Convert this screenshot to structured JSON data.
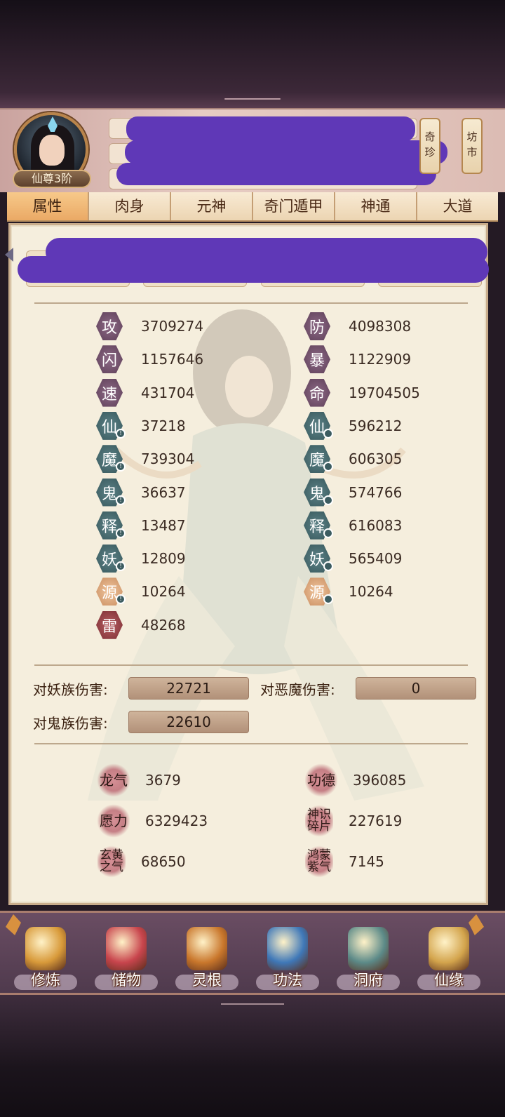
{
  "header": {
    "rank": "仙尊3阶",
    "side_buttons": [
      "奇珍",
      "坊市"
    ]
  },
  "tabs": [
    "属性",
    "肉身",
    "元神",
    "奇门遁甲",
    "神通",
    "大道"
  ],
  "active_tab": 0,
  "stats_left": [
    {
      "glyph": "攻",
      "value": "3709274",
      "style": "purple",
      "badge": ""
    },
    {
      "glyph": "闪",
      "value": "1157646",
      "style": "purple",
      "badge": ""
    },
    {
      "glyph": "速",
      "value": "431704",
      "style": "purple",
      "badge": ""
    },
    {
      "glyph": "仙",
      "value": "37218",
      "style": "teal",
      "badge": "!"
    },
    {
      "glyph": "魔",
      "value": "739304",
      "style": "teal",
      "badge": "!"
    },
    {
      "glyph": "鬼",
      "value": "36637",
      "style": "teal",
      "badge": "!"
    },
    {
      "glyph": "释",
      "value": "13487",
      "style": "teal",
      "badge": "!"
    },
    {
      "glyph": "妖",
      "value": "12809",
      "style": "teal",
      "badge": "!"
    },
    {
      "glyph": "源",
      "value": "10264",
      "style": "orange",
      "badge": "!"
    },
    {
      "glyph": "雷",
      "value": "48268",
      "style": "red",
      "badge": ""
    }
  ],
  "stats_right": [
    {
      "glyph": "防",
      "value": "4098308",
      "style": "purple",
      "badge": ""
    },
    {
      "glyph": "暴",
      "value": "1122909",
      "style": "purple",
      "badge": ""
    },
    {
      "glyph": "命",
      "value": "19704505",
      "style": "purple",
      "badge": ""
    },
    {
      "glyph": "仙",
      "value": "596212",
      "style": "teal",
      "badge": "o"
    },
    {
      "glyph": "魔",
      "value": "606305",
      "style": "teal",
      "badge": "o"
    },
    {
      "glyph": "鬼",
      "value": "574766",
      "style": "teal",
      "badge": "o"
    },
    {
      "glyph": "释",
      "value": "616083",
      "style": "teal",
      "badge": "o"
    },
    {
      "glyph": "妖",
      "value": "565409",
      "style": "teal",
      "badge": "o"
    },
    {
      "glyph": "源",
      "value": "10264",
      "style": "orange",
      "badge": "o"
    }
  ],
  "damage": {
    "yao_label": "对妖族伤害:",
    "yao_value": "22721",
    "demon_label": "对恶魔伤害:",
    "demon_value": "0",
    "ghost_label": "对鬼族伤害:",
    "ghost_value": "22610"
  },
  "misc": [
    {
      "label": "龙气",
      "value": "3679"
    },
    {
      "label": "功德",
      "value": "396085"
    },
    {
      "label": "愿力",
      "value": "6329423"
    },
    {
      "label": "神识碎片",
      "value": "227619"
    },
    {
      "label": "玄黄之气",
      "value": "68650"
    },
    {
      "label": "鸿蒙紫气",
      "value": "7145"
    }
  ],
  "bottom_nav": [
    {
      "label": "修炼",
      "icon": "cultivate-icon",
      "color": "#d89a3a"
    },
    {
      "label": "储物",
      "icon": "storage-bag-icon",
      "color": "#c8454d"
    },
    {
      "label": "灵根",
      "icon": "spirit-root-icon",
      "color": "#c9772c"
    },
    {
      "label": "功法",
      "icon": "technique-book-icon",
      "color": "#3f78b8"
    },
    {
      "label": "洞府",
      "icon": "cave-mansion-icon",
      "color": "#5c8a88"
    },
    {
      "label": "仙缘",
      "icon": "gourd-icon",
      "color": "#d3a44c"
    }
  ]
}
